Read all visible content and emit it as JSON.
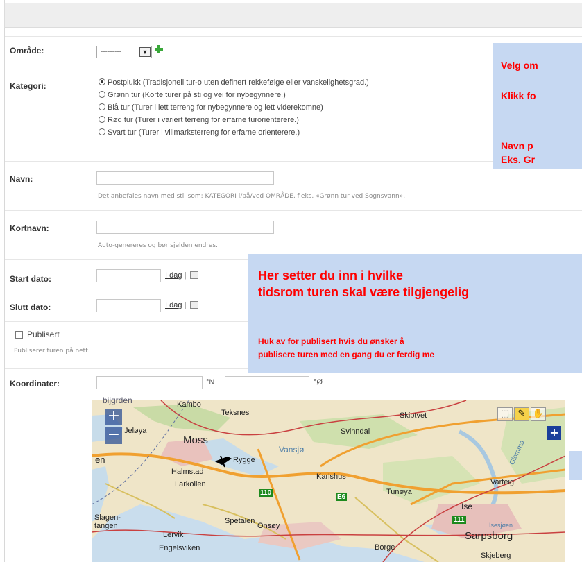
{
  "form": {
    "omrade": {
      "label": "Område:",
      "select_value": "---------"
    },
    "kategori": {
      "label": "Kategori:",
      "options": [
        "Postplukk (Tradisjonell tur-o uten definert rekkefølge eller vanskelighetsgrad.)",
        "Grønn tur (Korte turer på sti og vei for nybegynnere.)",
        "Blå tur (Turer i lett terreng for nybegynnere og lett viderekomne)",
        "Rød tur (Turer i variert terreng for erfarne turorienterere.)",
        "Svart tur (Turer i villmarksterreng for erfarne orienterere.)"
      ],
      "selected_index": 0
    },
    "navn": {
      "label": "Navn:",
      "value": "",
      "help": "Det anbefales navn med stil som: KATEGORI i/på/ved OMRÅDE, f.eks. «Grønn tur ved Sognsvann»."
    },
    "kortnavn": {
      "label": "Kortnavn:",
      "value": "",
      "help": "Auto-genereres og bør sjelden endres."
    },
    "start_dato": {
      "label": "Start dato:",
      "value": "",
      "today": "I dag",
      "sep": "|"
    },
    "slutt_dato": {
      "label": "Slutt dato:",
      "value": "",
      "today": "I dag",
      "sep": "|"
    },
    "publisert": {
      "label": "Publisert",
      "checked": false,
      "help": "Publiserer turen på nett."
    },
    "koordinater": {
      "label": "Koordinater:",
      "lat_unit": "°N",
      "lon_unit": "°Ø",
      "lat": "",
      "lon": ""
    }
  },
  "notes": {
    "top_line1": "Velg om",
    "top_line2": "Klikk fo",
    "top_line3": "Navn p",
    "top_line4": "Eks. Gr",
    "date_line1": "Her setter du inn i hvilke",
    "date_line2": "tidsrom turen skal være tilgjengelig",
    "pub_line1": "Huk av for publisert hvis du ønsker å",
    "pub_line2": "publisere turen med en gang du er ferdig me"
  },
  "map": {
    "places": [
      "Kambo",
      "Teksnes",
      "Skiptvet",
      "Jeløya",
      "Moss",
      "Svinndal",
      "Vansjø",
      "Rygge",
      "Halmstad",
      "Larkollen",
      "Karlshus",
      "Tunøya",
      "Varteig",
      "Ise",
      "Isesjøen",
      "Slagen-",
      "tangen",
      "Lervik",
      "Spetalen",
      "Onsøy",
      "Engelsviken",
      "Borge",
      "Sarpsborg",
      "Skjeberg",
      "Glomma",
      "en"
    ],
    "roads": [
      "110",
      "E6",
      "111"
    ],
    "zoom_in": "+",
    "zoom_out": "−"
  },
  "colors": {
    "note_bg": "#c6d8f2",
    "note_text": "#ff0000"
  }
}
